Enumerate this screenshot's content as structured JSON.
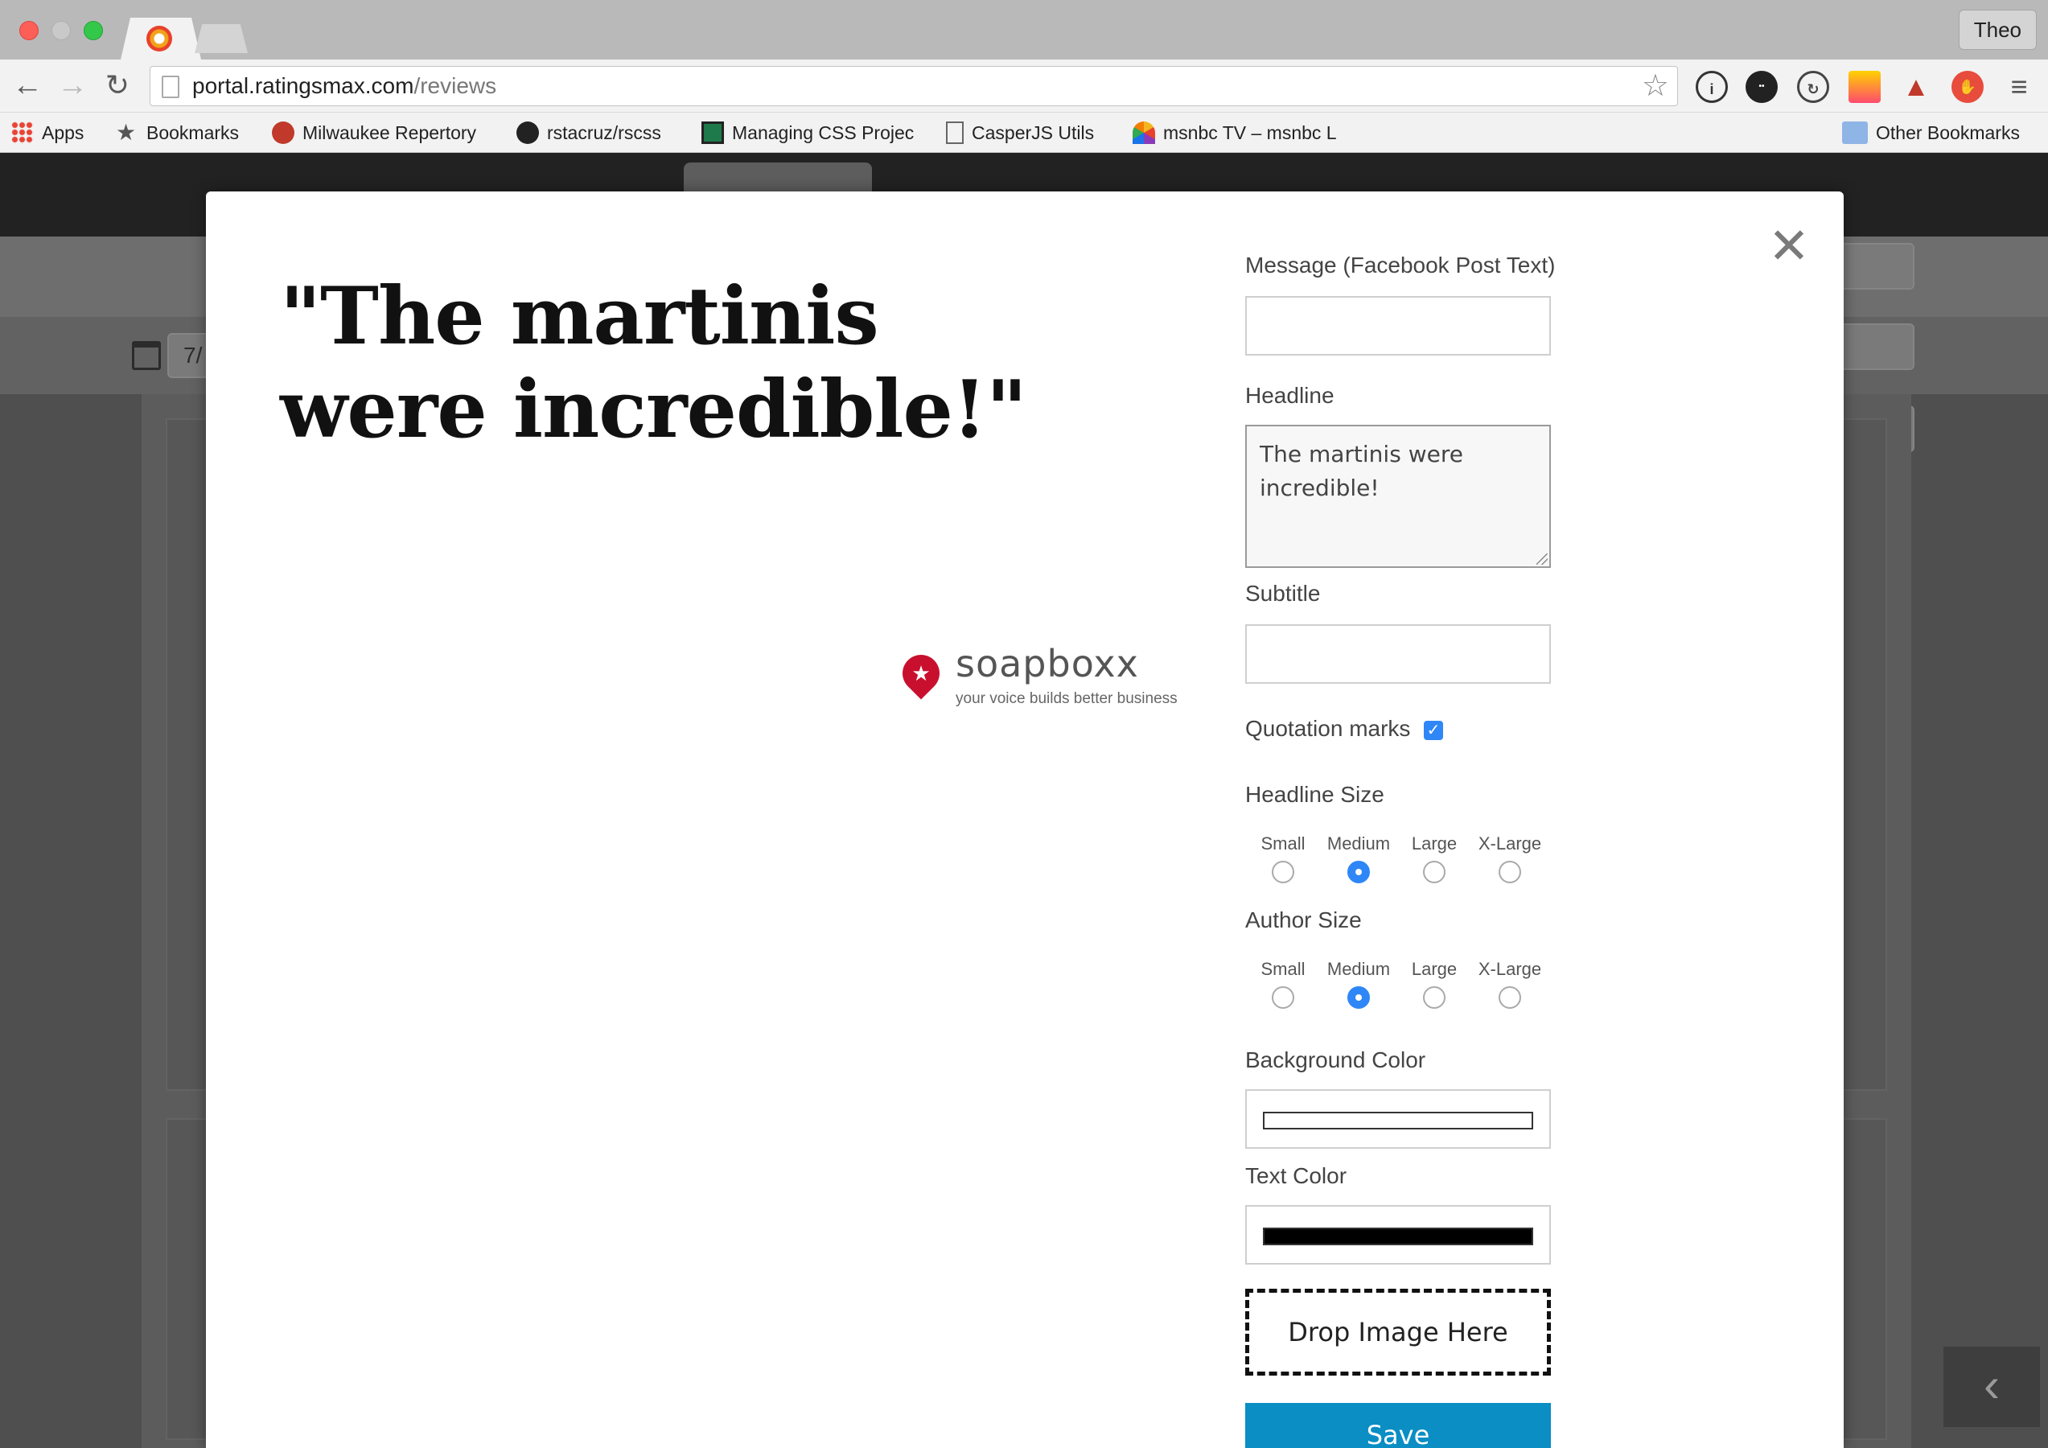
{
  "browser": {
    "profile": "Theo",
    "url_host": "portal.ratingsmax.com",
    "url_path": "/reviews",
    "bookmarks": [
      {
        "label": "Apps"
      },
      {
        "label": "Bookmarks"
      },
      {
        "label": "Milwaukee Repertory"
      },
      {
        "label": "rstacruz/rscss"
      },
      {
        "label": "Managing CSS Projec"
      },
      {
        "label": "CasperJS Utils"
      },
      {
        "label": "msnbc TV – msnbc L"
      },
      {
        "label": "Other Bookmarks"
      }
    ]
  },
  "background_page": {
    "date_fragment": "7/"
  },
  "modal": {
    "preview": {
      "headline": "\"The martinis were incredible!\"",
      "logo_brand": "soapboxx",
      "logo_tagline": "your voice builds better business"
    },
    "form": {
      "message_label": "Message (Facebook Post Text)",
      "message_value": "",
      "headline_label": "Headline",
      "headline_value": "The martinis were incredible!",
      "subtitle_label": "Subtitle",
      "subtitle_value": "",
      "quotation_label": "Quotation marks",
      "quotation_checked": true,
      "headline_size_label": "Headline Size",
      "author_size_label": "Author Size",
      "size_options": [
        "Small",
        "Medium",
        "Large",
        "X-Large"
      ],
      "headline_size_selected": "Medium",
      "author_size_selected": "Medium",
      "bg_color_label": "Background Color",
      "bg_color_value": "#ffffff",
      "text_color_label": "Text Color",
      "text_color_value": "#000000",
      "drop_label": "Drop Image Here",
      "save_label": "Save"
    }
  }
}
